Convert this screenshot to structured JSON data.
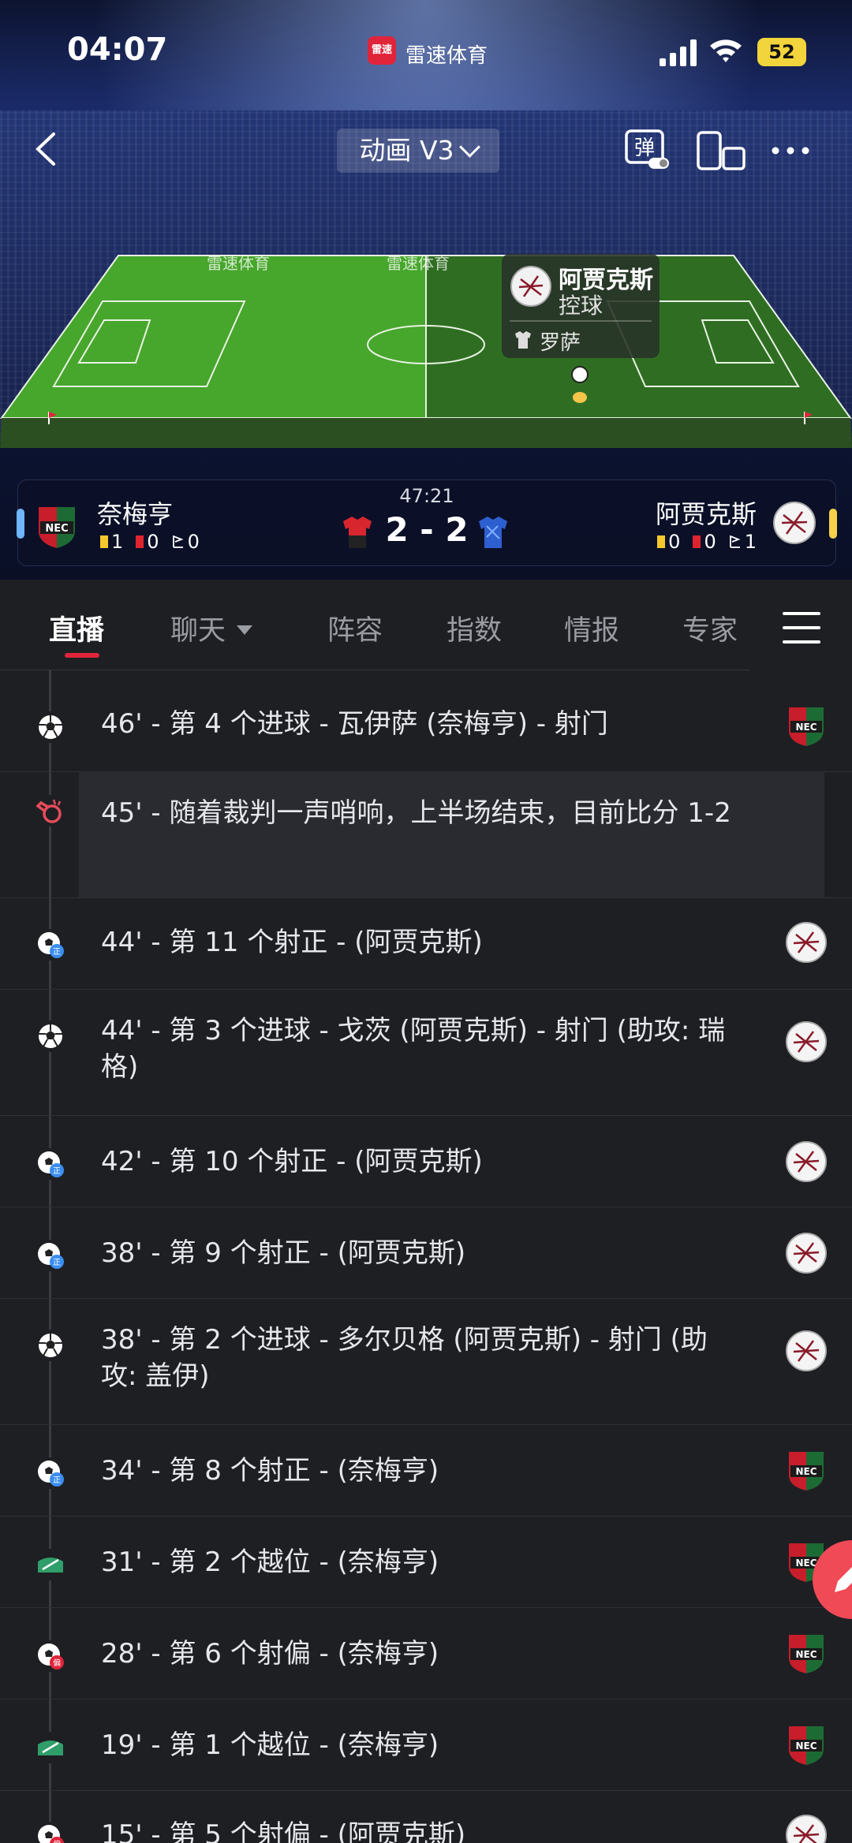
{
  "status_bar": {
    "time": "04:07",
    "app_name": "雷速体育",
    "app_badge": "雷速",
    "battery": "52"
  },
  "header": {
    "mode_label": "动画 V3",
    "danmu_label": "弹"
  },
  "field": {
    "banner_texts": [
      "雷速体育",
      "雷速体育",
      "雷速体育"
    ]
  },
  "possession": {
    "team": "阿贾克斯",
    "status": "控球",
    "player": "罗萨"
  },
  "match": {
    "time": "47:21",
    "score": "2 - 2",
    "home": {
      "name": "奈梅亨",
      "yellow": "1",
      "red": "0",
      "corners": "0"
    },
    "away": {
      "name": "阿贾克斯",
      "yellow": "0",
      "red": "0",
      "corners": "1"
    }
  },
  "tabs": [
    "直播",
    "聊天",
    "阵容",
    "指数",
    "情报",
    "专家"
  ],
  "events": [
    {
      "text": "46' - 第 4 个进球 - 瓦伊萨 (奈梅亨) - 射门",
      "icon": "goal-icon",
      "team": "home"
    },
    {
      "text": "45' - 随着裁判一声哨响，上半场结束，目前比分 1-2",
      "icon": "whistle-icon",
      "team": ""
    },
    {
      "text": "44' - 第 11 个射正 - (阿贾克斯)",
      "icon": "shot-on-target-icon",
      "team": "away"
    },
    {
      "text": "44' - 第 3 个进球 - 戈茨 (阿贾克斯) - 射门 (助攻: 瑞格)",
      "icon": "goal-icon",
      "team": "away"
    },
    {
      "text": "42' - 第 10 个射正 - (阿贾克斯)",
      "icon": "shot-on-target-icon",
      "team": "away"
    },
    {
      "text": "38' - 第 9 个射正 - (阿贾克斯)",
      "icon": "shot-on-target-icon",
      "team": "away"
    },
    {
      "text": "38' - 第 2 个进球 - 多尔贝格 (阿贾克斯) - 射门 (助攻: 盖伊)",
      "icon": "goal-icon",
      "team": "away"
    },
    {
      "text": "34' - 第 8 个射正 - (奈梅亨)",
      "icon": "shot-on-target-icon",
      "team": "home"
    },
    {
      "text": "31' - 第 2 个越位 - (奈梅亨)",
      "icon": "offside-icon",
      "team": "home"
    },
    {
      "text": "28' - 第 6 个射偏 - (奈梅亨)",
      "icon": "shot-off-target-icon",
      "team": "home"
    },
    {
      "text": "19' - 第 1 个越位 - (奈梅亨)",
      "icon": "offside-icon",
      "team": "home"
    },
    {
      "text": "15' - 第 5 个射偏 - (阿贾克斯)",
      "icon": "shot-off-target-icon",
      "team": "away"
    }
  ],
  "colors": {
    "accent": "#e0243a",
    "home_indicator": "#6fb5ff",
    "away_indicator": "#f6d24a",
    "pitch": "#4fa82f"
  }
}
